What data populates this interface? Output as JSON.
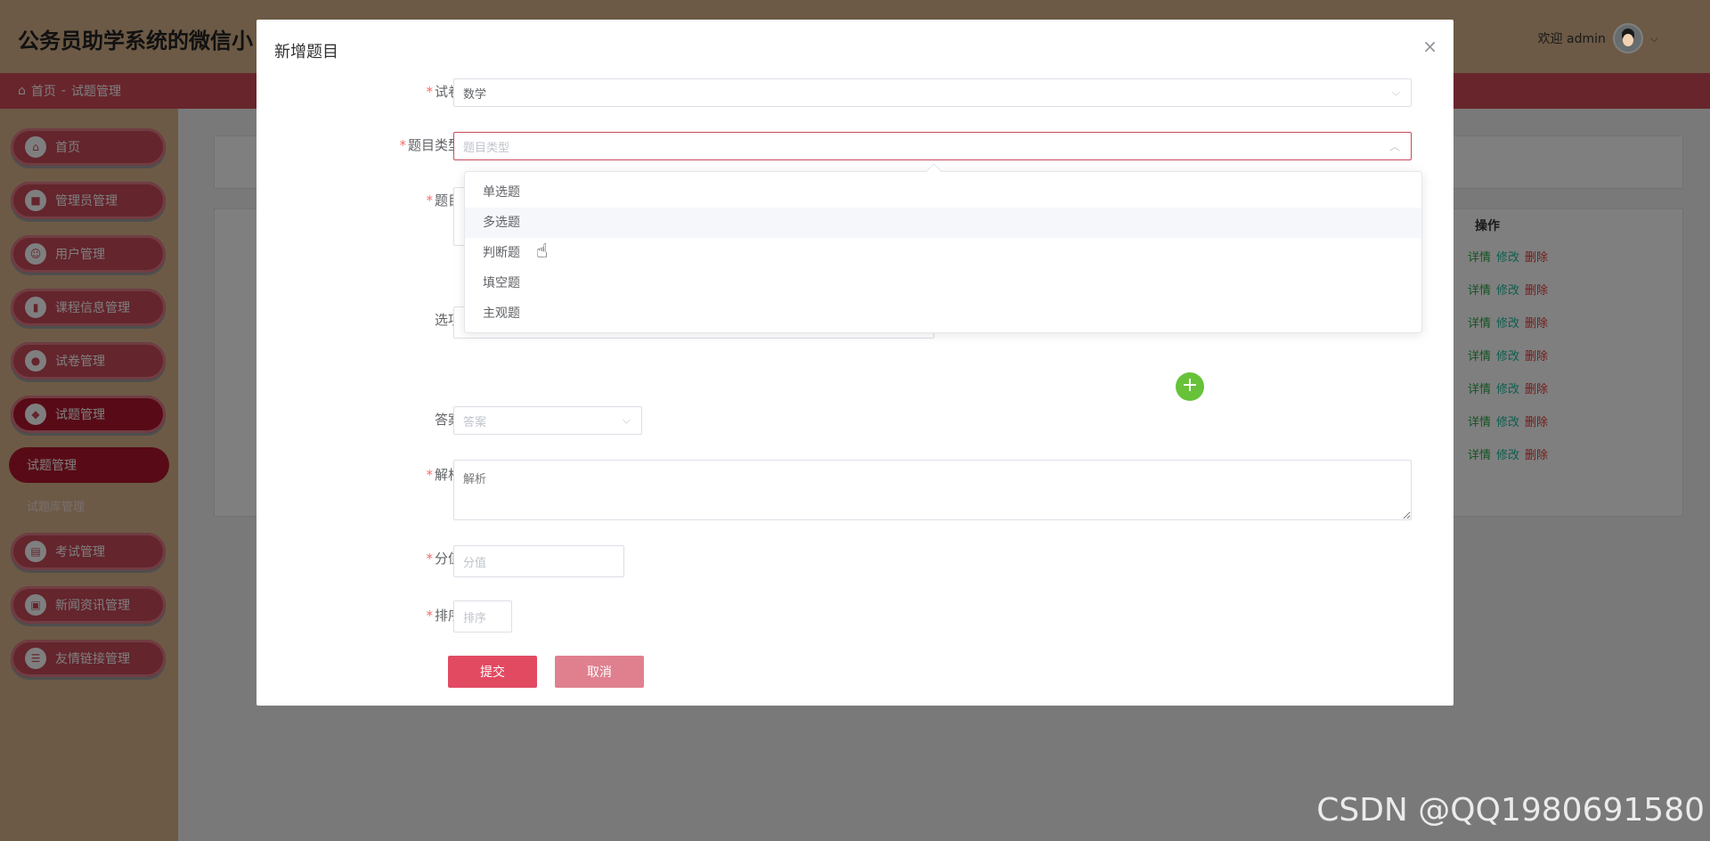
{
  "app": {
    "title": "公务员助学系统的微信小",
    "welcome": "欢迎 admin"
  },
  "breadcrumb": {
    "home": "首页",
    "separator": "-",
    "current": "试题管理"
  },
  "sidebar": {
    "items": [
      {
        "label": "首页",
        "icon": "home-icon"
      },
      {
        "label": "管理员管理",
        "icon": "admin-icon"
      },
      {
        "label": "用户管理",
        "icon": "user-icon"
      },
      {
        "label": "课程信息管理",
        "icon": "course-icon"
      },
      {
        "label": "试卷管理",
        "icon": "paper-icon"
      },
      {
        "label": "试题管理",
        "icon": "question-icon"
      },
      {
        "label": "考试管理",
        "icon": "exam-icon"
      },
      {
        "label": "新闻资讯管理",
        "icon": "news-icon"
      },
      {
        "label": "友情链接管理",
        "icon": "link-icon"
      }
    ],
    "submenu_active": "试题管理",
    "submenu_other": "试题库管理"
  },
  "table": {
    "op_header": "操作",
    "ops": {
      "detail": "详情",
      "edit": "修改",
      "delete": "删除"
    },
    "row_count": 7
  },
  "modal": {
    "title": "新增题目",
    "fields": {
      "paper_label": "试卷",
      "paper_value": "数学",
      "type_label": "题目类型",
      "type_placeholder": "题目类型",
      "question_label": "题目",
      "options_label": "选项",
      "answer_label": "答案",
      "answer_placeholder": "答案",
      "analysis_label": "解析",
      "analysis_placeholder": "解析",
      "score_label": "分值",
      "score_placeholder": "分值",
      "sort_label": "排序",
      "sort_placeholder": "排序"
    },
    "type_options": [
      "单选题",
      "多选题",
      "判断题",
      "填空题",
      "主观题"
    ],
    "hovered_option": "多选题",
    "submit": "提交",
    "cancel": "取消"
  },
  "watermark": "CSDN @QQ1980691580",
  "colors": {
    "brand": "#c94a5a",
    "topbar": "#d8b48c",
    "add_button": "#67c23a"
  }
}
